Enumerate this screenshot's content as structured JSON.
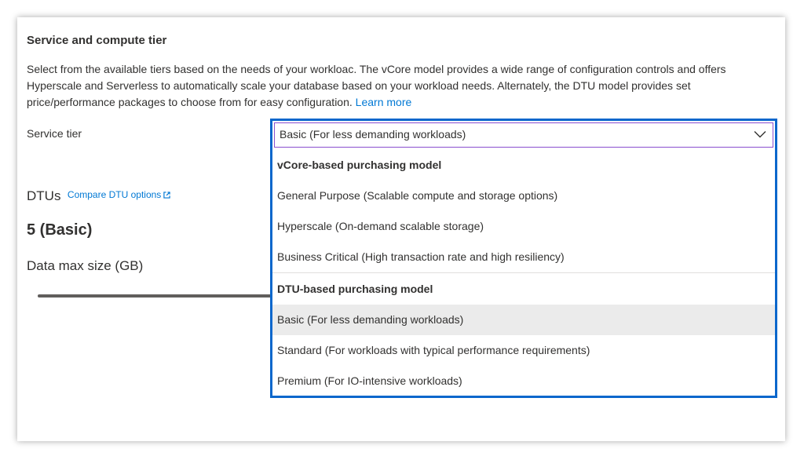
{
  "section": {
    "title": "Service and compute tier",
    "description": "Select from the available tiers based on the needs of your workloac. The vCore model provides a wide range of configuration controls and offers Hyperscale and Serverless to automatically scale your database based on your workload needs. Alternately, the DTU model provides set price/performance packages to choose from for easy configuration.",
    "learn_more": "Learn more"
  },
  "service_tier": {
    "label": "Service tier",
    "selected": "Basic (For less demanding workloads)",
    "groups": [
      {
        "header": "vCore-based purchasing model",
        "options": [
          "General Purpose (Scalable compute and storage options)",
          "Hyperscale (On-demand scalable storage)",
          "Business Critical (High transaction rate and high resiliency)"
        ]
      },
      {
        "header": "DTU-based purchasing model",
        "options": [
          "Basic (For less demanding workloads)",
          "Standard (For workloads with typical performance requirements)",
          "Premium (For IO-intensive workloads)"
        ]
      }
    ]
  },
  "dtus": {
    "label": "DTUs",
    "compare_link": "Compare DTU options",
    "value": "5 (Basic)"
  },
  "data_max_size": {
    "label": "Data max size (GB)"
  },
  "icons": {
    "dropdown": "chevron-down-icon",
    "external": "external-link-icon"
  },
  "colors": {
    "link": "#0078d4",
    "focus_border": "#0a67cc",
    "select_border": "#8a4ecf",
    "selected_row": "#ebebeb"
  }
}
